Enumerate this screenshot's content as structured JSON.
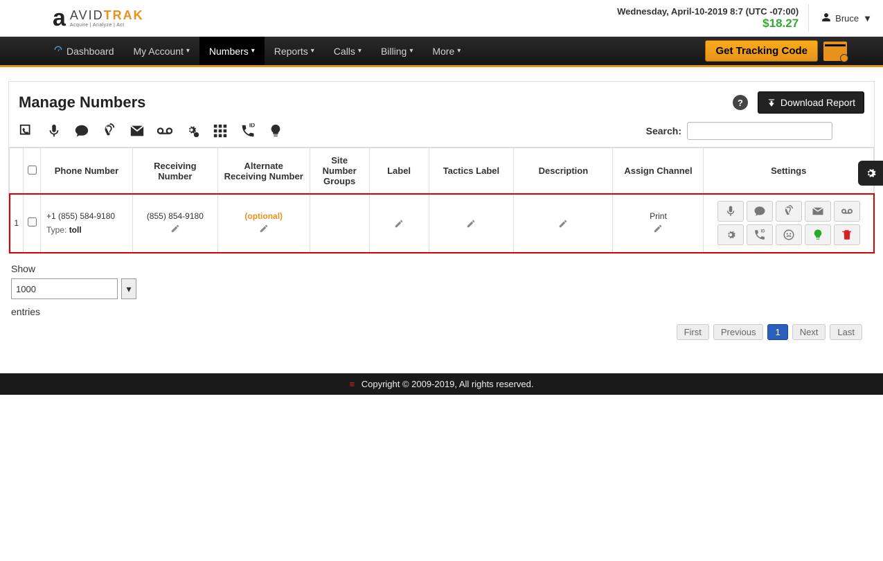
{
  "header": {
    "logo_brand_plain": "AVID",
    "logo_brand_accent": "TRAK",
    "logo_tagline": "Acquire | Analyze | Act",
    "datetime": "Wednesday, April-10-2019 8:7 (UTC -07:00)",
    "balance": "$18.27",
    "username": "Bruce"
  },
  "nav": {
    "items": [
      "Dashboard",
      "My Account",
      "Numbers",
      "Reports",
      "Calls",
      "Billing",
      "More"
    ],
    "active_index": 2,
    "tracking_button": "Get Tracking Code"
  },
  "page": {
    "title": "Manage Numbers",
    "download_button": "Download Report",
    "search_label": "Search:"
  },
  "table": {
    "columns": [
      "",
      "",
      "Phone Number",
      "Receiving Number",
      "Alternate Receiving Number",
      "Site Number Groups",
      "Label",
      "Tactics Label",
      "Description",
      "Assign Channel",
      "Settings"
    ],
    "row": {
      "index": "1",
      "phone": "+1 (855) 584-9180",
      "type_label": "Type: ",
      "type_value": "toll",
      "receiving": "(855) 854-9180",
      "alternate": "(optional)",
      "channel": "Print"
    }
  },
  "pagination_controls": {
    "show_label": "Show",
    "entries_label": "entries",
    "page_size": "1000",
    "buttons": [
      "First",
      "Previous",
      "1",
      "Next",
      "Last"
    ],
    "active_page_index": 2
  },
  "footer": {
    "text": "Copyright © 2009-2019, All rights reserved."
  }
}
